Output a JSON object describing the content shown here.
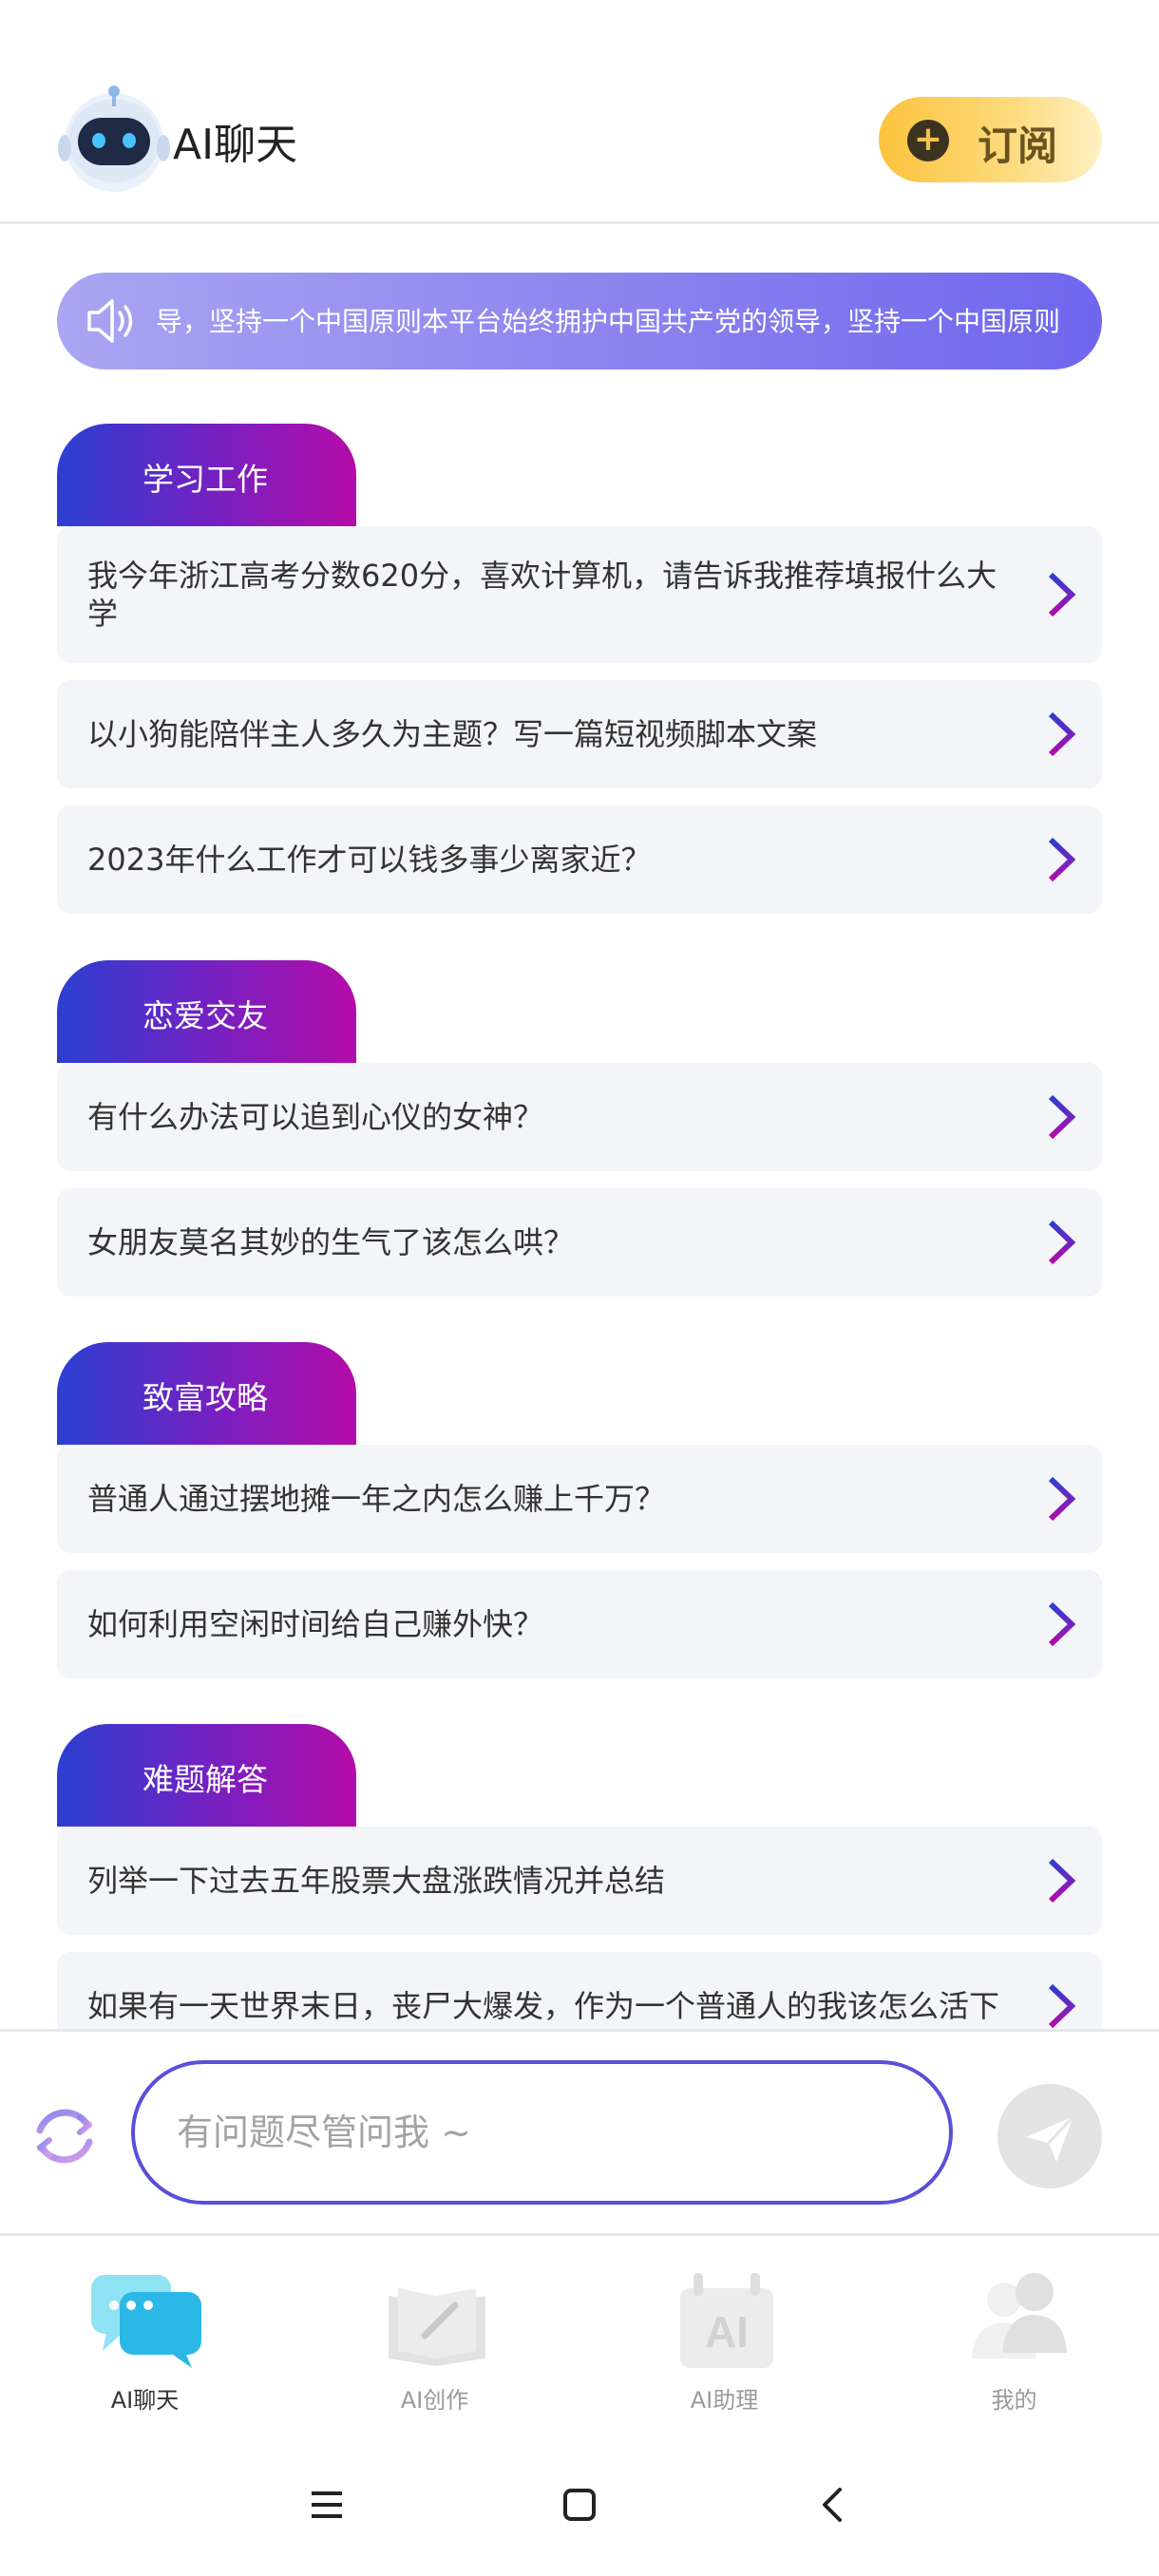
{
  "header": {
    "app_title": "AI聊天",
    "subscribe_label": "订阅",
    "subscribe_icon": "plus-icon"
  },
  "notice": {
    "text": "导，坚持一个中国原则本平台始终拥护中国共产党的领导，坚持一个中国原则",
    "icon": "speaker-icon"
  },
  "categories": [
    {
      "title": "学习工作",
      "questions": [
        "我今年浙江高考分数620分，喜欢计算机，请告诉我推荐填报什么大学",
        "以小狗能陪伴主人多久为主题？写一篇短视频脚本文案",
        "2023年什么工作才可以钱多事少离家近？"
      ]
    },
    {
      "title": "恋爱交友",
      "questions": [
        "有什么办法可以追到心仪的女神？",
        "女朋友莫名其妙的生气了该怎么哄？"
      ]
    },
    {
      "title": "致富攻略",
      "questions": [
        "普通人通过摆地摊一年之内怎么赚上千万？",
        "如何利用空闲时间给自己赚外快？"
      ]
    },
    {
      "title": "难题解答",
      "questions": [
        "列举一下过去五年股票大盘涨跌情况并总结",
        "如果有一天世界末日，丧尸大爆发，作为一个普通人的我该怎么活下"
      ]
    }
  ],
  "input": {
    "placeholder": "有问题尽管问我 ~"
  },
  "nav": {
    "items": [
      {
        "label": "AI聊天",
        "icon": "chat-bubbles-icon",
        "active": true
      },
      {
        "label": "AI创作",
        "icon": "book-pen-icon",
        "active": false
      },
      {
        "label": "AI助理",
        "icon": "ai-assistant-icon",
        "active": false
      },
      {
        "label": "我的",
        "icon": "users-icon",
        "active": false
      }
    ]
  },
  "colors": {
    "accent": "#5a4fd9",
    "tab_start": "#2b3fd1",
    "tab_end": "#b40ca8",
    "subscribe": "#fbc33d"
  }
}
